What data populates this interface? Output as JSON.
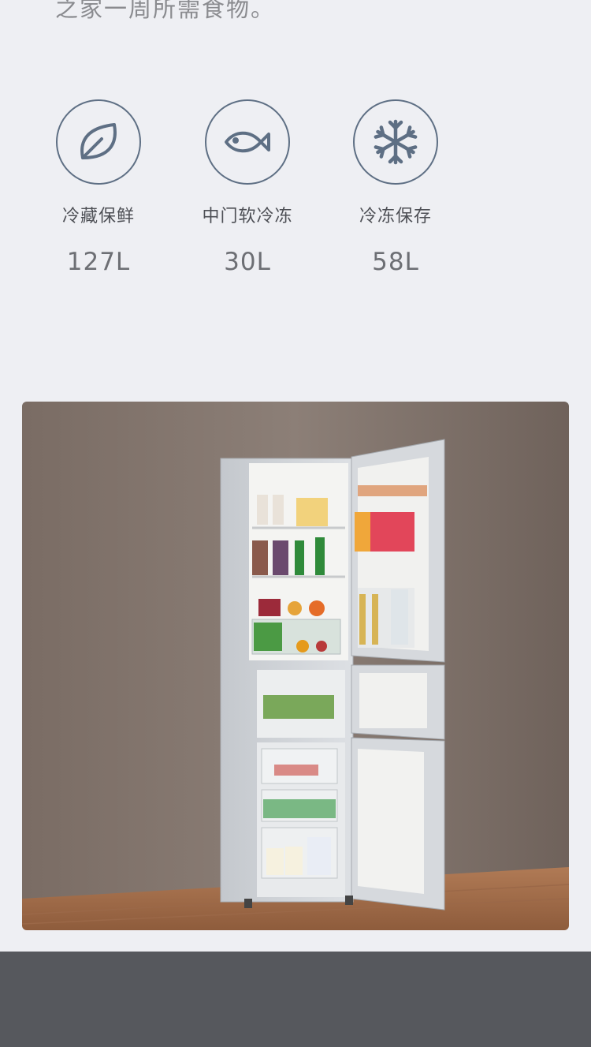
{
  "intro_text": "之家一周所需食物。",
  "features": [
    {
      "icon": "leaf-icon",
      "label": "冷藏保鲜",
      "value": "127L"
    },
    {
      "icon": "fish-icon",
      "label": "中门软冷冻",
      "value": "30L"
    },
    {
      "icon": "snowflake-icon",
      "label": "冷冻保存",
      "value": "58L"
    }
  ],
  "colors": {
    "icon_stroke": "#5e6f84",
    "background": "#eeeff3",
    "footer": "#56585d"
  }
}
